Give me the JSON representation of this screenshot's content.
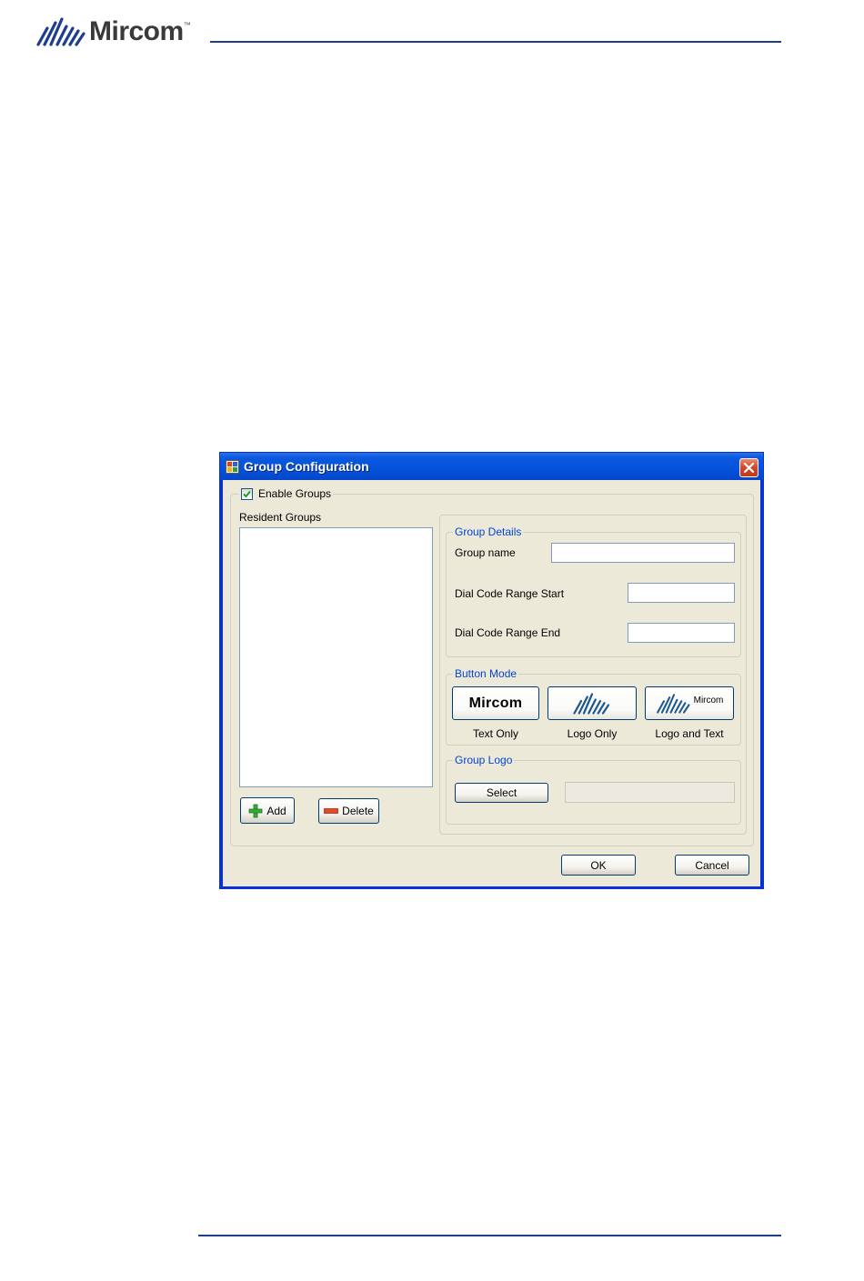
{
  "brand": {
    "name": "Mircom",
    "tm": "™"
  },
  "dialog": {
    "title": "Group Configuration",
    "enable_groups": {
      "label": "Enable Groups",
      "checked": true
    },
    "resident_groups": {
      "label": "Resident Groups",
      "items": []
    },
    "add_label": "Add",
    "delete_label": "Delete",
    "group_details": {
      "title": "Group Details",
      "group_name_label": "Group name",
      "group_name_value": "",
      "dial_start_label": "Dial Code Range Start",
      "dial_start_value": "",
      "dial_end_label": "Dial Code Range End",
      "dial_end_value": ""
    },
    "button_mode": {
      "title": "Button Mode",
      "text_only_sample": "Mircom",
      "logo_text_sample": "Mircom",
      "captions": [
        "Text Only",
        "Logo Only",
        "Logo and Text"
      ]
    },
    "group_logo": {
      "title": "Group Logo",
      "select_label": "Select"
    },
    "ok_label": "OK",
    "cancel_label": "Cancel"
  },
  "colors": {
    "accent": "#1f3d8f",
    "titlebar": "#0553db",
    "dialog_bg": "#ece9d8",
    "group_title": "#0046d5"
  }
}
